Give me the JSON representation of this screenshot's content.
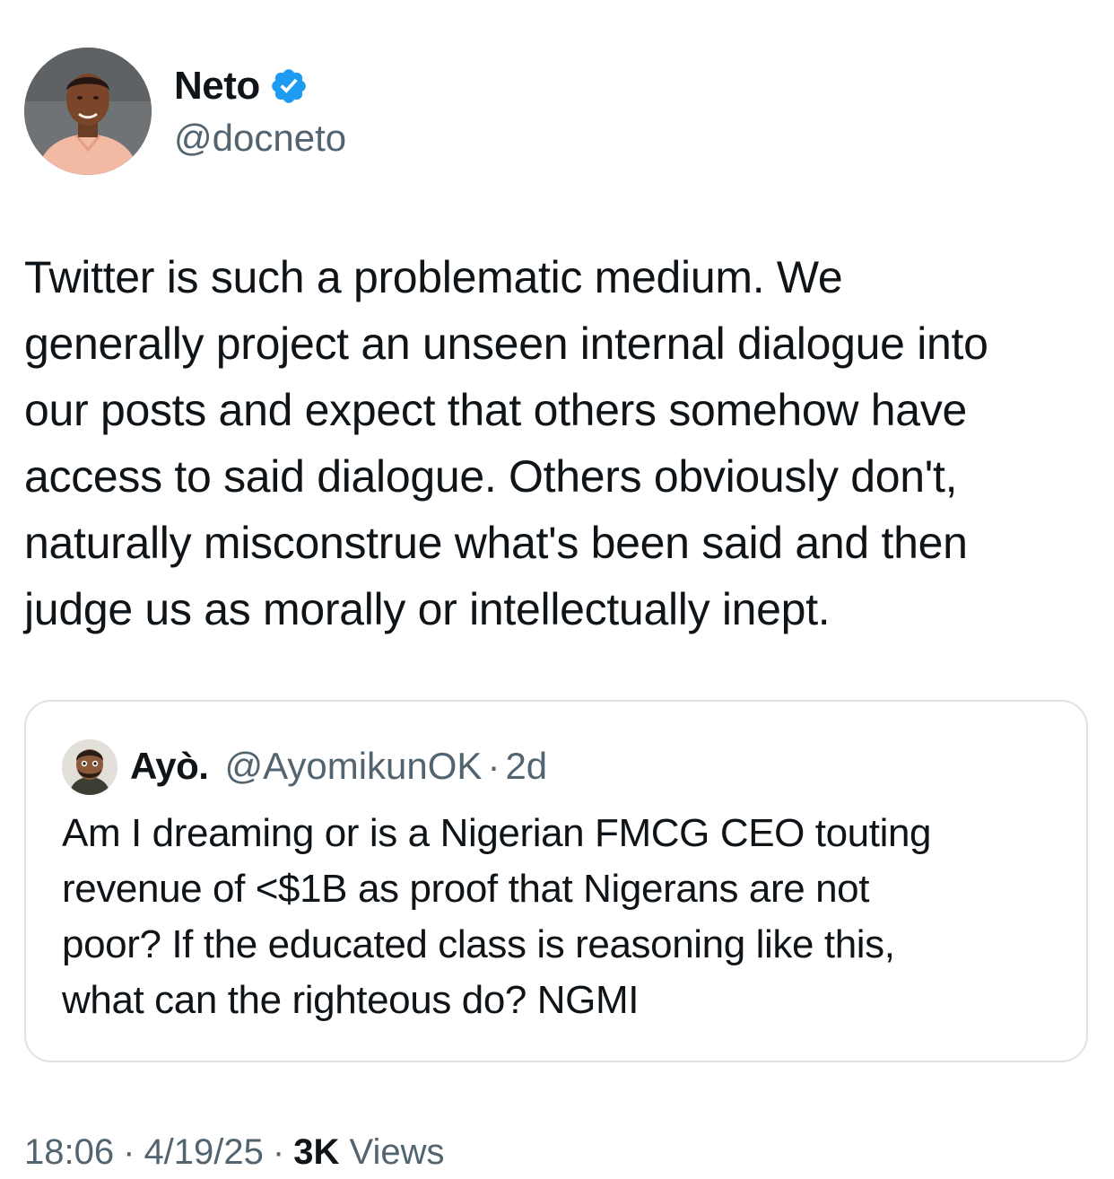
{
  "author": {
    "name": "Neto",
    "handle": "@docneto",
    "verified_icon": "verified-badge-icon"
  },
  "tweet": {
    "text": "Twitter is such a problematic medium. We\ngenerally project an unseen internal dialogue into\nour posts and expect that others somehow have\naccess to said dialogue. Others obviously don't,\nnaturally misconstrue what's been said and then\njudge us as morally or intellectually inept."
  },
  "quote": {
    "name": "Ayò.",
    "handle": "@AyomikunOK",
    "separator": "·",
    "time": "2d",
    "text": "Am I dreaming or is a Nigerian FMCG CEO touting\nrevenue of <$1B as proof that Nigerans are not\npoor? If the educated class is reasoning like this,\nwhat can the righteous do? NGMI"
  },
  "meta": {
    "time": "18:06",
    "separator": "·",
    "date": "4/19/25",
    "views_count": "3K",
    "views_label": "Views"
  },
  "colors": {
    "text_primary": "#0f1419",
    "text_secondary": "#536471",
    "verified_blue": "#1d9bf0",
    "card_border": "#dfe3e6"
  }
}
